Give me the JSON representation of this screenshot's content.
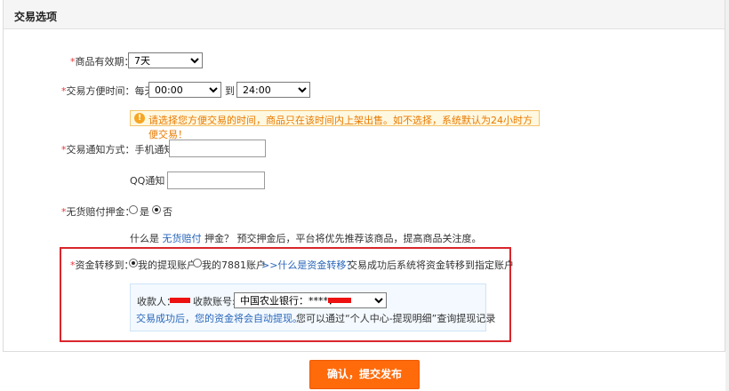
{
  "section_title": "交易选项",
  "required_mark": "*",
  "validity": {
    "label": "商品有效期：",
    "value": "7天"
  },
  "trade_time": {
    "label": "交易方便时间：",
    "prefix": "每天",
    "from": "00:00",
    "to_label": "到",
    "to": "24:00"
  },
  "tip": {
    "icon": "!",
    "text": "请选择您方便交易的时间，商品只在该时间内上架出售。如不选择，系统默认为24小时方便交易！"
  },
  "notify": {
    "label": "交易通知方式：",
    "phone_label": "手机通知",
    "phone_value": "",
    "qq_label": "QQ通知",
    "qq_value": ""
  },
  "deposit": {
    "label": "无货赔付押金：",
    "yes": "是",
    "no": "否",
    "selected": "no",
    "hint_prefix": "什么是",
    "hint_link": "无货赔付",
    "hint_suffix": "押金？ 预交押金后，平台将优先推荐该商品，提高商品关注度。"
  },
  "transfer": {
    "label": "资金转移到：",
    "option1": "我的提现账户",
    "option2": "我的7881账户",
    "selected": "option1",
    "help_link": ">>什么是资金转移？",
    "help_text": "交易成功后系统将资金转移到指定账户",
    "payee_label": "收款人：",
    "account_label": "收款账号:",
    "account_value": "中国农业银行：****：",
    "note_link": "交易成功后，您的资金将会自动提现。",
    "note_text": "您可以通过“个人中心-提现明细”查询提现记录"
  },
  "submit_label": "确认，提交发布",
  "colors": {
    "accent": "#ff6a0b",
    "required": "#e4393c",
    "link": "#2a66b8",
    "highlight_border": "#d9262c"
  }
}
